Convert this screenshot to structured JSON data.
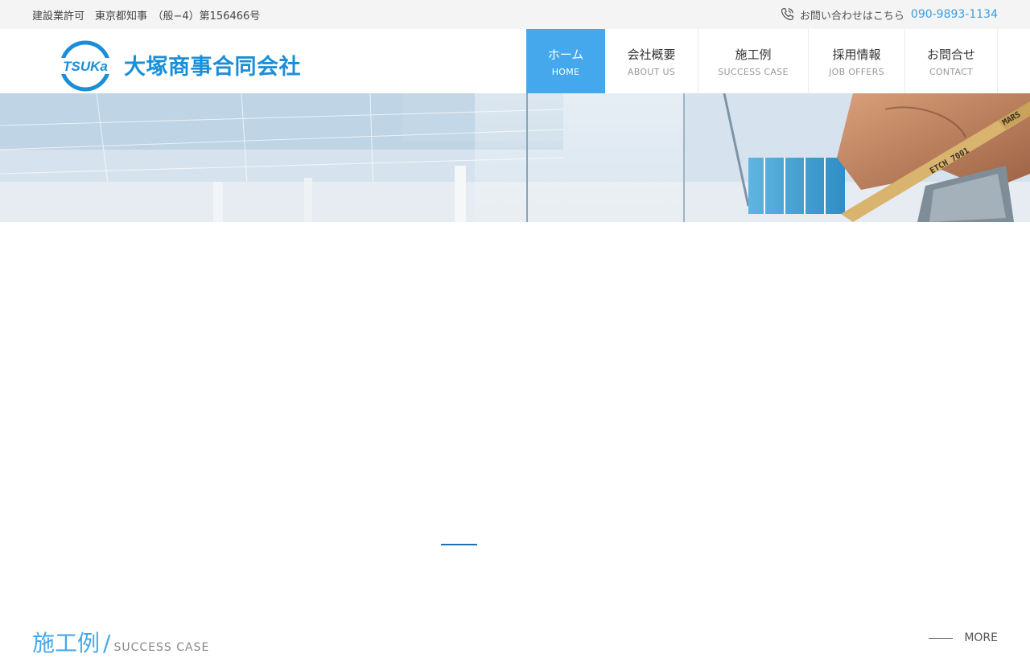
{
  "topbar": {
    "license": "建設業許可　東京都知事　（般−4）第156466号",
    "contact_label": "お問い合わせはこちら",
    "phone": "090-9893-1134"
  },
  "header": {
    "logo_text": "TSUKa",
    "company_name": "大塚商事合同会社"
  },
  "nav": [
    {
      "jp": "ホーム",
      "en": "HOME"
    },
    {
      "jp": "会社概要",
      "en": "ABOUT US"
    },
    {
      "jp": "施工例",
      "en": "SUCCESS CASE"
    },
    {
      "jp": "採用情報",
      "en": "JOB OFFERS"
    },
    {
      "jp": "お問合せ",
      "en": "CONTACT"
    }
  ],
  "section": {
    "title_jp": "施工例",
    "title_en": "SUCCESS CASE",
    "more": "MORE"
  },
  "colors": {
    "accent": "#45a8ec",
    "brand": "#1a8fd8"
  }
}
